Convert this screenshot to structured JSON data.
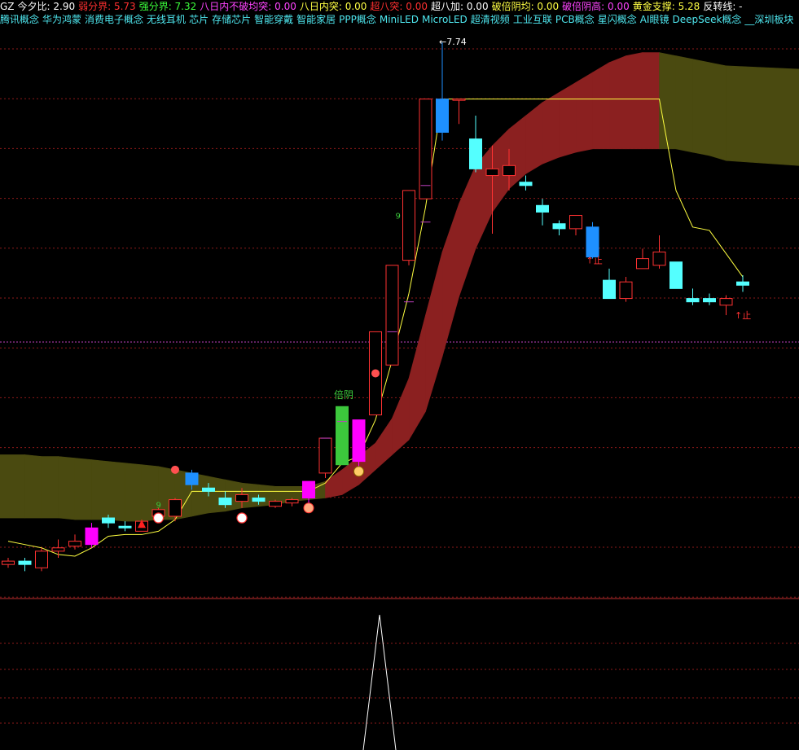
{
  "header": {
    "prefix": "GZ",
    "indicators": [
      {
        "label": "今夕比:",
        "value": "2.90",
        "color": "#ffffff"
      },
      {
        "label": "弱分界:",
        "value": "5.73",
        "color": "#ff3030"
      },
      {
        "label": "强分界:",
        "value": "7.32",
        "color": "#3cff3c"
      },
      {
        "label": "八日内不破均突:",
        "value": "0.00",
        "color": "#ff44ff"
      },
      {
        "label": "八日内突:",
        "value": "0.00",
        "color": "#ffff44"
      },
      {
        "label": "超八突:",
        "value": "0.00",
        "color": "#ff3030"
      },
      {
        "label": "超八加:",
        "value": "0.00",
        "color": "#ffffff"
      },
      {
        "label": "破倍阴均:",
        "value": "0.00",
        "color": "#ffff44"
      },
      {
        "label": "破倍阴高:",
        "value": "0.00",
        "color": "#ff44ff"
      },
      {
        "label": "黄金支撑:",
        "value": "5.28",
        "color": "#ffff44"
      },
      {
        "label": "反转线:",
        "value": "-",
        "color": "#ffffff"
      }
    ]
  },
  "concepts": [
    "腾讯概念",
    "华为鸿蒙",
    "消费电子概念",
    "无线耳机",
    "芯片",
    "存储芯片",
    "智能穿戴",
    "智能家居",
    "PPP概念",
    "MiniLED",
    "MicroLED",
    "超清视频",
    "工业互联",
    "PCB概念",
    "星闪概念",
    "AI眼镜",
    "DeepSeek概念",
    "__深圳板块"
  ],
  "colors": {
    "up": "#ff3232",
    "down": "#54ffff",
    "strong_up": "#ff00ff",
    "strong_down": "#1e90ff",
    "green": "#3cc83c",
    "ma": "#ffff40",
    "band_red": "#8b2020",
    "band_olive": "#4a4a10",
    "grid": "#8b1a1a",
    "purple_line": "#c040c0"
  },
  "chart_data": {
    "type": "candlestick",
    "price_range": [
      4.4,
      7.8
    ],
    "max_label": "7.74",
    "labels": {
      "double_yin": "倍阴",
      "stop": "止",
      "nine": "9"
    },
    "candles": [
      {
        "o": 4.62,
        "h": 4.64,
        "l": 4.58,
        "c": 4.6,
        "style": "up"
      },
      {
        "o": 4.6,
        "h": 4.64,
        "l": 4.56,
        "c": 4.62,
        "style": "down"
      },
      {
        "o": 4.58,
        "h": 4.7,
        "l": 4.56,
        "c": 4.68,
        "style": "up"
      },
      {
        "o": 4.68,
        "h": 4.75,
        "l": 4.64,
        "c": 4.7,
        "style": "up"
      },
      {
        "o": 4.71,
        "h": 4.78,
        "l": 4.69,
        "c": 4.74,
        "style": "up"
      },
      {
        "o": 4.82,
        "h": 4.85,
        "l": 4.7,
        "c": 4.72,
        "style": "strong_up"
      },
      {
        "o": 4.88,
        "h": 4.9,
        "l": 4.82,
        "c": 4.85,
        "style": "down"
      },
      {
        "o": 4.83,
        "h": 4.86,
        "l": 4.8,
        "c": 4.82,
        "style": "down"
      },
      {
        "o": 4.8,
        "h": 4.87,
        "l": 4.8,
        "c": 4.86,
        "style": "up"
      },
      {
        "o": 4.89,
        "h": 4.94,
        "l": 4.86,
        "c": 4.93,
        "style": "up"
      },
      {
        "o": 4.89,
        "h": 5.0,
        "l": 4.86,
        "c": 4.99,
        "style": "up"
      },
      {
        "o": 5.15,
        "h": 5.17,
        "l": 5.05,
        "c": 5.08,
        "style": "strong_down"
      },
      {
        "o": 5.06,
        "h": 5.09,
        "l": 5.01,
        "c": 5.04,
        "style": "down"
      },
      {
        "o": 5.0,
        "h": 5.04,
        "l": 4.94,
        "c": 4.96,
        "style": "down"
      },
      {
        "o": 4.98,
        "h": 5.06,
        "l": 4.94,
        "c": 5.02,
        "style": "up"
      },
      {
        "o": 5.0,
        "h": 5.02,
        "l": 4.96,
        "c": 4.98,
        "style": "down"
      },
      {
        "o": 4.95,
        "h": 4.99,
        "l": 4.94,
        "c": 4.98,
        "style": "up"
      },
      {
        "o": 4.97,
        "h": 5.0,
        "l": 4.95,
        "c": 4.99,
        "style": "up"
      },
      {
        "o": 5.0,
        "h": 5.1,
        "l": 4.97,
        "c": 5.1,
        "style": "strong_up"
      },
      {
        "o": 5.15,
        "h": 5.36,
        "l": 5.12,
        "c": 5.36,
        "style": "up"
      },
      {
        "o": 5.2,
        "h": 5.55,
        "l": 5.2,
        "c": 5.55,
        "style": "green"
      },
      {
        "o": 5.47,
        "h": 5.47,
        "l": 5.16,
        "c": 5.22,
        "style": "strong_up"
      },
      {
        "o": 5.5,
        "h": 6.0,
        "l": 5.5,
        "c": 6.0,
        "style": "up"
      },
      {
        "o": 5.8,
        "h": 6.4,
        "l": 5.8,
        "c": 6.4,
        "style": "up"
      },
      {
        "o": 6.43,
        "h": 6.85,
        "l": 6.4,
        "c": 6.85,
        "style": "up"
      },
      {
        "o": 6.8,
        "h": 7.4,
        "l": 6.8,
        "c": 7.4,
        "style": "up"
      },
      {
        "o": 7.2,
        "h": 7.74,
        "l": 7.15,
        "c": 7.4,
        "style": "strong_down"
      },
      {
        "o": 7.4,
        "h": 7.4,
        "l": 7.25,
        "c": 7.4,
        "style": "up"
      },
      {
        "o": 7.16,
        "h": 7.3,
        "l": 6.96,
        "c": 6.98,
        "style": "down"
      },
      {
        "o": 6.94,
        "h": 7.12,
        "l": 6.59,
        "c": 6.98,
        "style": "up"
      },
      {
        "o": 6.94,
        "h": 7.1,
        "l": 6.85,
        "c": 7.0,
        "style": "up"
      },
      {
        "o": 6.9,
        "h": 6.94,
        "l": 6.85,
        "c": 6.88,
        "style": "down"
      },
      {
        "o": 6.76,
        "h": 6.8,
        "l": 6.64,
        "c": 6.72,
        "style": "down"
      },
      {
        "o": 6.65,
        "h": 6.67,
        "l": 6.58,
        "c": 6.62,
        "style": "down"
      },
      {
        "o": 6.62,
        "h": 6.7,
        "l": 6.58,
        "c": 6.7,
        "style": "up"
      },
      {
        "o": 6.63,
        "h": 6.66,
        "l": 6.44,
        "c": 6.45,
        "style": "strong_down"
      },
      {
        "o": 6.31,
        "h": 6.38,
        "l": 6.2,
        "c": 6.2,
        "style": "down"
      },
      {
        "o": 6.2,
        "h": 6.33,
        "l": 6.18,
        "c": 6.3,
        "style": "up"
      },
      {
        "o": 6.38,
        "h": 6.5,
        "l": 6.38,
        "c": 6.44,
        "style": "up"
      },
      {
        "o": 6.4,
        "h": 6.58,
        "l": 6.38,
        "c": 6.48,
        "style": "up"
      },
      {
        "o": 6.42,
        "h": 6.42,
        "l": 6.26,
        "c": 6.26,
        "style": "down"
      },
      {
        "o": 6.2,
        "h": 6.26,
        "l": 6.16,
        "c": 6.18,
        "style": "down"
      },
      {
        "o": 6.2,
        "h": 6.23,
        "l": 6.16,
        "c": 6.18,
        "style": "down"
      },
      {
        "o": 6.16,
        "h": 6.22,
        "l": 6.1,
        "c": 6.2,
        "style": "up"
      },
      {
        "o": 6.28,
        "h": 6.34,
        "l": 6.24,
        "c": 6.3,
        "style": "down"
      }
    ],
    "ma_line": [
      4.74,
      4.72,
      4.7,
      4.66,
      4.65,
      4.7,
      4.77,
      4.78,
      4.78,
      4.8,
      4.87,
      5.04,
      5.04,
      5.04,
      5.04,
      5.04,
      5.04,
      5.04,
      5.04,
      5.09,
      5.21,
      5.25,
      5.47,
      5.83,
      6.23,
      6.75,
      7.4,
      7.4,
      7.4,
      7.4,
      7.4,
      7.4,
      7.4,
      7.4,
      7.4,
      7.4,
      7.4,
      7.4,
      7.4,
      7.4,
      6.85,
      6.63,
      6.61,
      6.47,
      6.33
    ],
    "band": [
      {
        "u": 5.26,
        "l": 4.88,
        "c": "olive"
      },
      {
        "u": 5.26,
        "l": 4.88,
        "c": "olive"
      },
      {
        "u": 5.25,
        "l": 4.88,
        "c": "olive"
      },
      {
        "u": 5.25,
        "l": 4.88,
        "c": "olive"
      },
      {
        "u": 5.24,
        "l": 4.87,
        "c": "olive"
      },
      {
        "u": 5.23,
        "l": 4.87,
        "c": "olive"
      },
      {
        "u": 5.22,
        "l": 4.87,
        "c": "olive"
      },
      {
        "u": 5.21,
        "l": 4.86,
        "c": "olive"
      },
      {
        "u": 5.2,
        "l": 4.86,
        "c": "olive"
      },
      {
        "u": 5.19,
        "l": 4.87,
        "c": "olive"
      },
      {
        "u": 5.17,
        "l": 4.87,
        "c": "olive"
      },
      {
        "u": 5.15,
        "l": 4.89,
        "c": "olive"
      },
      {
        "u": 5.13,
        "l": 4.91,
        "c": "olive"
      },
      {
        "u": 5.11,
        "l": 4.92,
        "c": "olive"
      },
      {
        "u": 5.09,
        "l": 4.94,
        "c": "olive"
      },
      {
        "u": 5.08,
        "l": 4.95,
        "c": "olive"
      },
      {
        "u": 5.07,
        "l": 4.96,
        "c": "olive"
      },
      {
        "u": 5.07,
        "l": 4.98,
        "c": "olive"
      },
      {
        "u": 5.07,
        "l": 4.99,
        "c": "olive"
      },
      {
        "u": 5.1,
        "l": 5.0,
        "c": "red"
      },
      {
        "u": 5.17,
        "l": 5.02,
        "c": "red"
      },
      {
        "u": 5.25,
        "l": 5.08,
        "c": "red"
      },
      {
        "u": 5.33,
        "l": 5.17,
        "c": "red"
      },
      {
        "u": 5.48,
        "l": 5.26,
        "c": "red"
      },
      {
        "u": 5.72,
        "l": 5.35,
        "c": "red"
      },
      {
        "u": 6.1,
        "l": 5.52,
        "c": "red"
      },
      {
        "u": 6.48,
        "l": 5.85,
        "c": "red"
      },
      {
        "u": 6.77,
        "l": 6.21,
        "c": "red"
      },
      {
        "u": 7.0,
        "l": 6.5,
        "c": "red"
      },
      {
        "u": 7.12,
        "l": 6.72,
        "c": "red"
      },
      {
        "u": 7.22,
        "l": 6.86,
        "c": "red"
      },
      {
        "u": 7.3,
        "l": 6.95,
        "c": "red"
      },
      {
        "u": 7.38,
        "l": 7.01,
        "c": "red"
      },
      {
        "u": 7.44,
        "l": 7.05,
        "c": "red"
      },
      {
        "u": 7.5,
        "l": 7.08,
        "c": "red"
      },
      {
        "u": 7.56,
        "l": 7.1,
        "c": "red"
      },
      {
        "u": 7.62,
        "l": 7.1,
        "c": "red"
      },
      {
        "u": 7.66,
        "l": 7.1,
        "c": "red"
      },
      {
        "u": 7.68,
        "l": 7.1,
        "c": "red"
      },
      {
        "u": 7.68,
        "l": 7.1,
        "c": "olive"
      },
      {
        "u": 7.66,
        "l": 7.1,
        "c": "olive"
      },
      {
        "u": 7.64,
        "l": 7.08,
        "c": "olive"
      },
      {
        "u": 7.62,
        "l": 7.06,
        "c": "olive"
      },
      {
        "u": 7.6,
        "l": 7.03,
        "c": "olive"
      },
      {
        "u": 7.58,
        "l": 7.0,
        "c": "olive"
      }
    ],
    "sub_pane": {
      "type": "line",
      "values_index": [
        20,
        21,
        22
      ],
      "peak_value": 1
    }
  }
}
